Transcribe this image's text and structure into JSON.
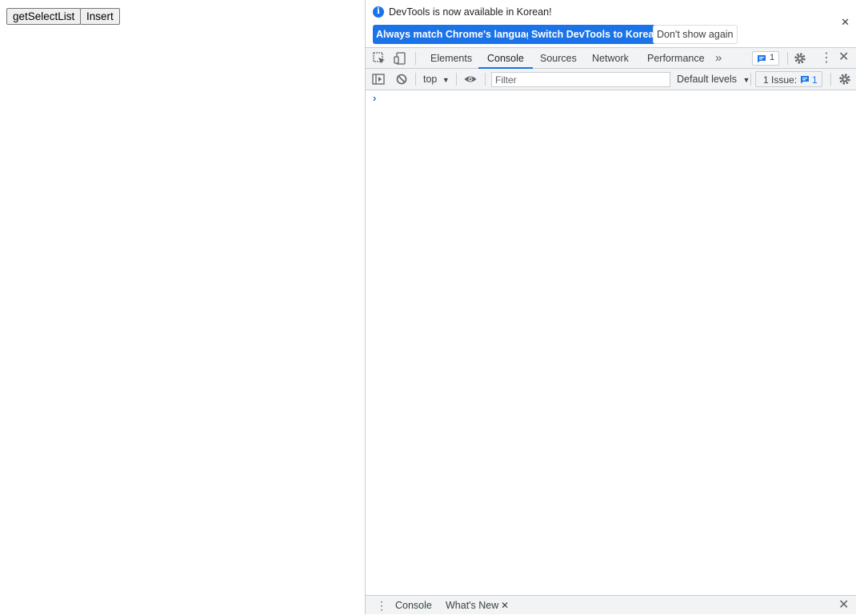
{
  "page": {
    "buttons": [
      {
        "label": "getSelectList"
      },
      {
        "label": "Insert"
      }
    ]
  },
  "infobar": {
    "message": "DevTools is now available in Korean!",
    "info_glyph": "i",
    "close_glyph": "✕",
    "actions": [
      {
        "label": "Always match Chrome's language"
      },
      {
        "label": "Switch DevTools to Korean"
      },
      {
        "label": "Don't show again"
      }
    ]
  },
  "tabs": {
    "items": [
      {
        "label": "Elements"
      },
      {
        "label": "Console",
        "active": true
      },
      {
        "label": "Sources"
      },
      {
        "label": "Network"
      },
      {
        "label": "Performance"
      }
    ],
    "more_glyph": "»",
    "issues_count": "1",
    "kebab_glyph": "⋮",
    "close_glyph": "✕"
  },
  "console_toolbar": {
    "context": "top",
    "context_arrow": "▼",
    "filter_placeholder": "Filter",
    "levels": "Default levels",
    "levels_arrow": "▼",
    "issues_label": "1 Issue:",
    "issues_count": "1"
  },
  "console": {
    "prompt_glyph": "›"
  },
  "drawer": {
    "kebab_glyph": "⋮",
    "tabs": [
      {
        "label": "Console"
      },
      {
        "label": "What's New"
      }
    ],
    "tab_close_glyph": "✕",
    "close_glyph": "✕"
  },
  "colors": {
    "accent": "#1a73e8",
    "toolbar_bg": "#f1f3f4",
    "border": "#cacdd1"
  }
}
